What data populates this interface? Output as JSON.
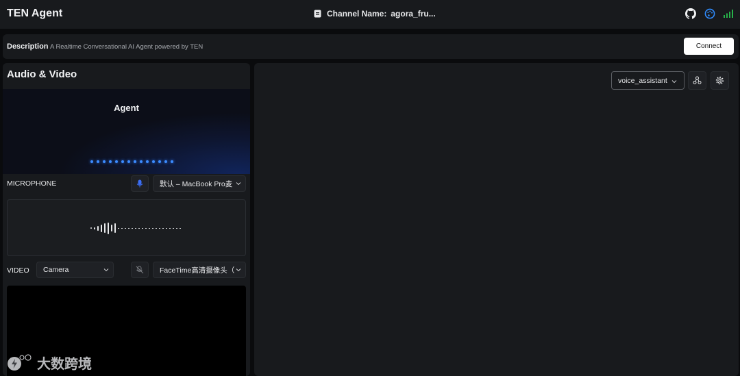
{
  "header": {
    "app_title": "TEN Agent",
    "channel_label": "Channel Name:",
    "channel_value": "agora_fru...",
    "icons": [
      "github-icon",
      "palette-icon",
      "signal-icon"
    ],
    "signal_color": "#27b24a",
    "palette_color": "#2f8cff"
  },
  "description": {
    "label": "Description",
    "text": "A Realtime Conversational AI Agent powered by TEN",
    "connect_label": "Connect"
  },
  "left_panel": {
    "title": "Audio & Video",
    "agent_label": "Agent",
    "microphone": {
      "label": "MICROPHONE",
      "device": "默认 – MacBook Pro麦"
    },
    "video": {
      "label": "VIDEO",
      "source": "Camera",
      "device": "FaceTime高清摄像头（"
    }
  },
  "right_panel": {
    "graph_select": "voice_assistant",
    "icons": [
      "network-icon",
      "settings-icon"
    ]
  },
  "watermark": {
    "text": "大数跨境"
  }
}
